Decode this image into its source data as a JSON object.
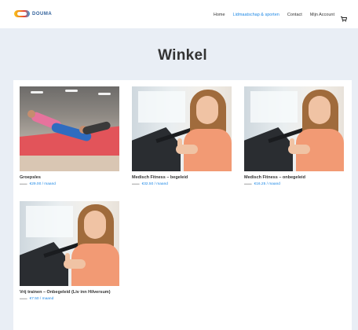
{
  "header": {
    "logo_text": "DOUMA",
    "nav": [
      {
        "label": "Home",
        "active": false
      },
      {
        "label": "Lidmaatschap & sporten",
        "active": true
      },
      {
        "label": "Contact",
        "active": false
      },
      {
        "label": "Mijn Account",
        "active": false
      }
    ],
    "cart_icon": "cart-icon"
  },
  "hero": {
    "title": "Winkel"
  },
  "colors": {
    "accent": "#1e88e5",
    "hero_bg": "#e9eef5",
    "old_price": "#b9b9b9"
  },
  "products": [
    {
      "name": "Groepsles",
      "old_price": "——",
      "price": "€29.00 / maand",
      "image": "group-class-photo"
    },
    {
      "name": "Medisch Fitness – begeleid",
      "old_price": "——",
      "price": "€32.50 / maand",
      "image": "fitness-woman-photo"
    },
    {
      "name": "Medisch Fitness – onbegeleid",
      "old_price": "——",
      "price": "€16.25 / maand",
      "image": "fitness-woman-photo"
    },
    {
      "name": "Vrij trainen – Onbegeleid (Liv inn Hilversum)",
      "old_price": "——",
      "price": "€7.50 / maand",
      "image": "fitness-woman-photo"
    }
  ]
}
